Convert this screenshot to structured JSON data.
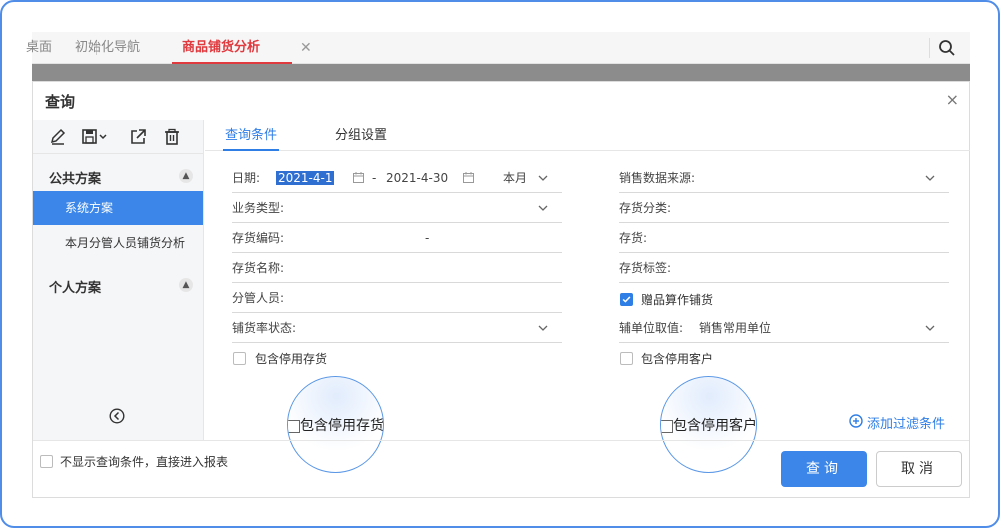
{
  "tabs": [
    {
      "label": "桌面"
    },
    {
      "label": "初始化导航"
    },
    {
      "label": "商品铺货分析"
    }
  ],
  "dialog": {
    "title": "查询",
    "close": "×"
  },
  "left_panel": {
    "public_group": "公共方案",
    "public_plans": [
      "系统方案",
      "本月分管人员铺货分析"
    ],
    "private_group": "个人方案"
  },
  "sub_tabs": [
    "查询条件",
    "分组设置"
  ],
  "form_left": {
    "date_label": "日期:",
    "date_from": "2021-4-1",
    "date_sep": "-",
    "date_to": "2021-4-30",
    "period": "本月",
    "biz_type_label": "业务类型:",
    "item_code_label": "存货编码:",
    "item_code_sep": "-",
    "item_name_label": "存货名称:",
    "manager_label": "分管人员:",
    "coverage_status_label": "铺货率状态:",
    "include_disabled_stock": "包含停用存货"
  },
  "form_right": {
    "source_label": "销售数据来源:",
    "category_label": "存货分类:",
    "stock_label": "存货:",
    "tag_label": "存货标签:",
    "gift_label": "赠品算作铺货",
    "gift_checked": true,
    "aux_unit_label": "辅单位取值:",
    "aux_unit_value": "销售常用单位",
    "include_disabled_customer": "包含停用客户"
  },
  "zoom_left": "包含停用存货",
  "zoom_right": "包含停用客户",
  "add_filter": "添加过滤条件",
  "footer": {
    "skip_label": "不显示查询条件，直接进入报表",
    "query": "查询",
    "cancel": "取消"
  },
  "colors": {
    "accent": "#3b86e8",
    "active_tab": "#e0393e"
  }
}
